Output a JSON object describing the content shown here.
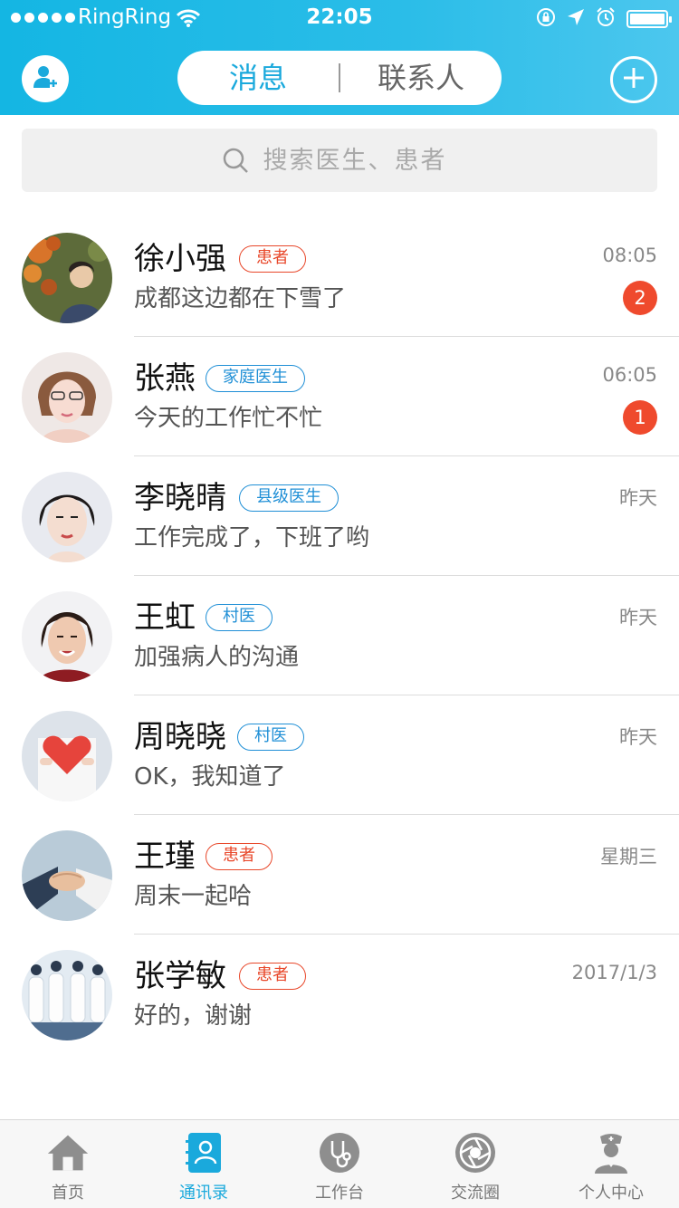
{
  "status_bar": {
    "carrier": "RingRing",
    "time": "22:05"
  },
  "header": {
    "tabs": [
      {
        "label": "消息",
        "active": true
      },
      {
        "label": "联系人",
        "active": false
      }
    ],
    "left_icon": "add-user-icon",
    "right_icon": "plus-icon"
  },
  "search": {
    "placeholder": "搜索医生、患者"
  },
  "conversations": [
    {
      "name": "徐小强",
      "tag": "患者",
      "tag_color": "#e8472a",
      "preview": "成都这边都在下雪了",
      "time": "08:05",
      "unread": "2"
    },
    {
      "name": "张燕",
      "tag": "家庭医生",
      "tag_color": "#1f8fd6",
      "preview": "今天的工作忙不忙",
      "time": "06:05",
      "unread": "1"
    },
    {
      "name": "李晓晴",
      "tag": "县级医生",
      "tag_color": "#1f8fd6",
      "preview": "工作完成了，下班了哟",
      "time": "昨天",
      "unread": ""
    },
    {
      "name": "王虹",
      "tag": "村医",
      "tag_color": "#1f8fd6",
      "preview": "加强病人的沟通",
      "time": "昨天",
      "unread": ""
    },
    {
      "name": "周晓晓",
      "tag": "村医",
      "tag_color": "#1f8fd6",
      "preview": "OK，我知道了",
      "time": "昨天",
      "unread": ""
    },
    {
      "name": "王瑾",
      "tag": "患者",
      "tag_color": "#e8472a",
      "preview": "周末一起哈",
      "time": "星期三",
      "unread": ""
    },
    {
      "name": "张学敏",
      "tag": "患者",
      "tag_color": "#e8472a",
      "preview": "好的，谢谢",
      "time": "2017/1/3",
      "unread": ""
    }
  ],
  "tabbar": {
    "items": [
      {
        "label": "首页",
        "icon": "home-icon",
        "active": false
      },
      {
        "label": "通讯录",
        "icon": "contacts-icon",
        "active": true
      },
      {
        "label": "工作台",
        "icon": "stethoscope-icon",
        "active": false
      },
      {
        "label": "交流圈",
        "icon": "aperture-icon",
        "active": false
      },
      {
        "label": "个人中心",
        "icon": "nurse-icon",
        "active": false
      }
    ]
  },
  "colors": {
    "accent": "#1aa9dc",
    "patient_tag": "#e8472a",
    "doctor_tag": "#1f8fd6",
    "badge": "#ef4a2d"
  }
}
